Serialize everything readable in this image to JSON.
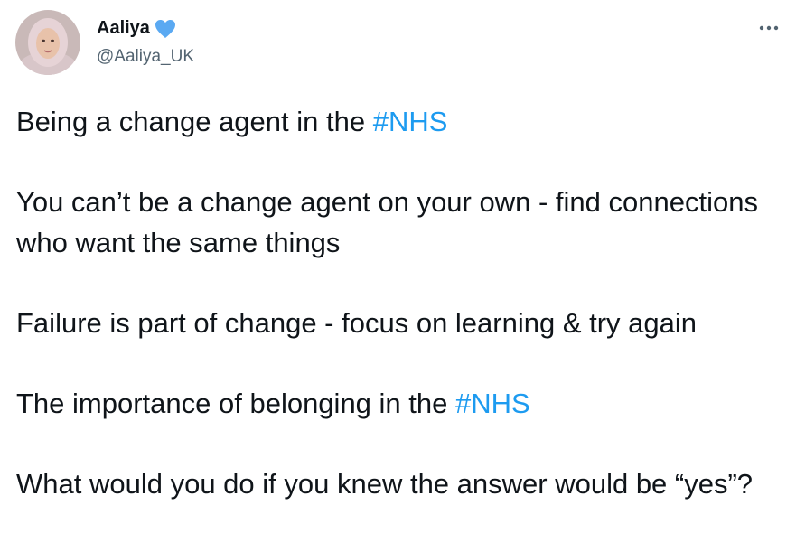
{
  "author": {
    "display_name": "Aaliya",
    "handle": "@Aaliya_UK",
    "badge_icon": "blue-heart-icon",
    "badge_color": "#5aa9f2",
    "avatar_icon": "profile-photo"
  },
  "more_icon": "more-options-icon",
  "colors": {
    "text": "#0f1419",
    "secondary": "#536471",
    "hashtag": "#1d9bf0"
  },
  "tweet": {
    "p1_text": "Being a change agent in the ",
    "p1_hashtag": "#NHS",
    "p2_text": "You can’t be a change agent on your own - find connections who want the same things",
    "p3_text": "Failure is part of change - focus on learning & try again",
    "p4_text": "The importance of belonging in the ",
    "p4_hashtag": "#NHS",
    "p5_text": "What would you do if you knew the answer would be “yes”?"
  }
}
